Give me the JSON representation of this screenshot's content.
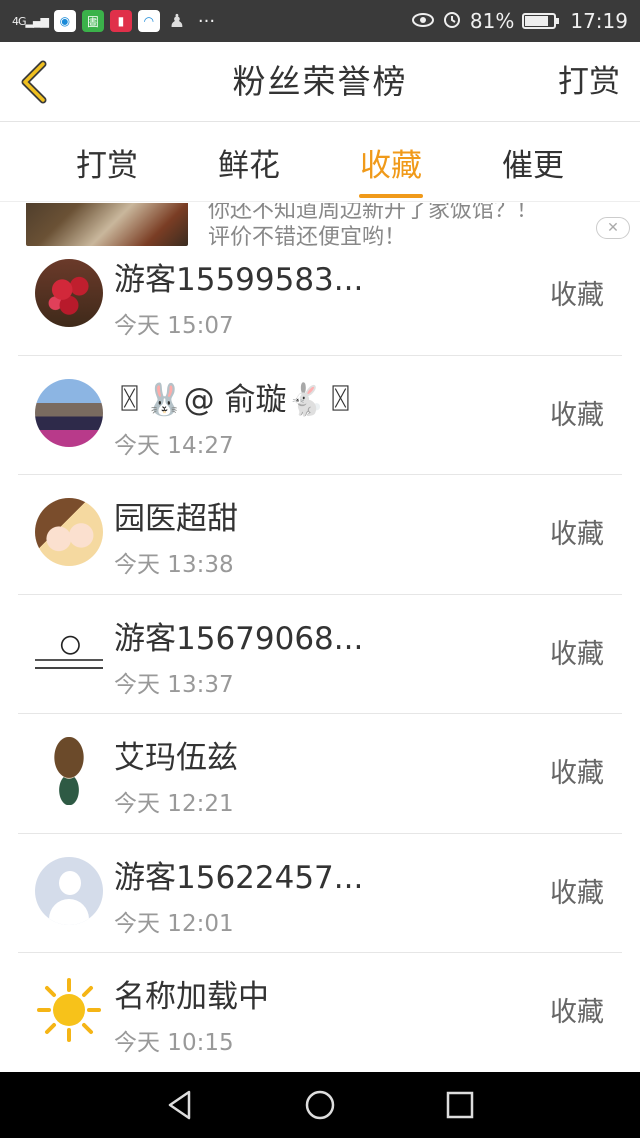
{
  "status_bar": {
    "network": "4G",
    "battery_percent": "81%",
    "battery_level": 0.81,
    "time": "17:19",
    "overflow": "···"
  },
  "header": {
    "title": "粉丝荣誉榜",
    "action_label": "打赏"
  },
  "tabs": [
    {
      "label": "打赏",
      "active": false
    },
    {
      "label": "鲜花",
      "active": false
    },
    {
      "label": "收藏",
      "active": true
    },
    {
      "label": "催更",
      "active": false
    }
  ],
  "ad": {
    "line1": "你还不知道周边新开了家饭馆？！",
    "line2": "评价不错还便宜哟！",
    "close": "✕"
  },
  "list": [
    {
      "name": "游客15599583...",
      "time": "今天 15:07",
      "action": "收藏",
      "avatar": "roses"
    },
    {
      "name": "〿🐰@ 俞璇🐇〿",
      "time": "今天 14:27",
      "action": "收藏",
      "avatar": "group"
    },
    {
      "name": "园医超甜",
      "time": "今天 13:38",
      "action": "收藏",
      "avatar": "anime"
    },
    {
      "name": "游客15679068...",
      "time": "今天 13:37",
      "action": "收藏",
      "avatar": "sketch"
    },
    {
      "name": "艾玛伍兹",
      "time": "今天 12:21",
      "action": "收藏",
      "avatar": "doll"
    },
    {
      "name": "游客15622457...",
      "time": "今天 12:01",
      "action": "收藏",
      "avatar": "default"
    },
    {
      "name": "名称加载中",
      "time": "今天 10:15",
      "action": "收藏",
      "avatar": "sun"
    }
  ],
  "colors": {
    "accent": "#f09a1a",
    "status_bar_bg": "#3a3a3a",
    "nav_bar_bg": "#000000"
  }
}
